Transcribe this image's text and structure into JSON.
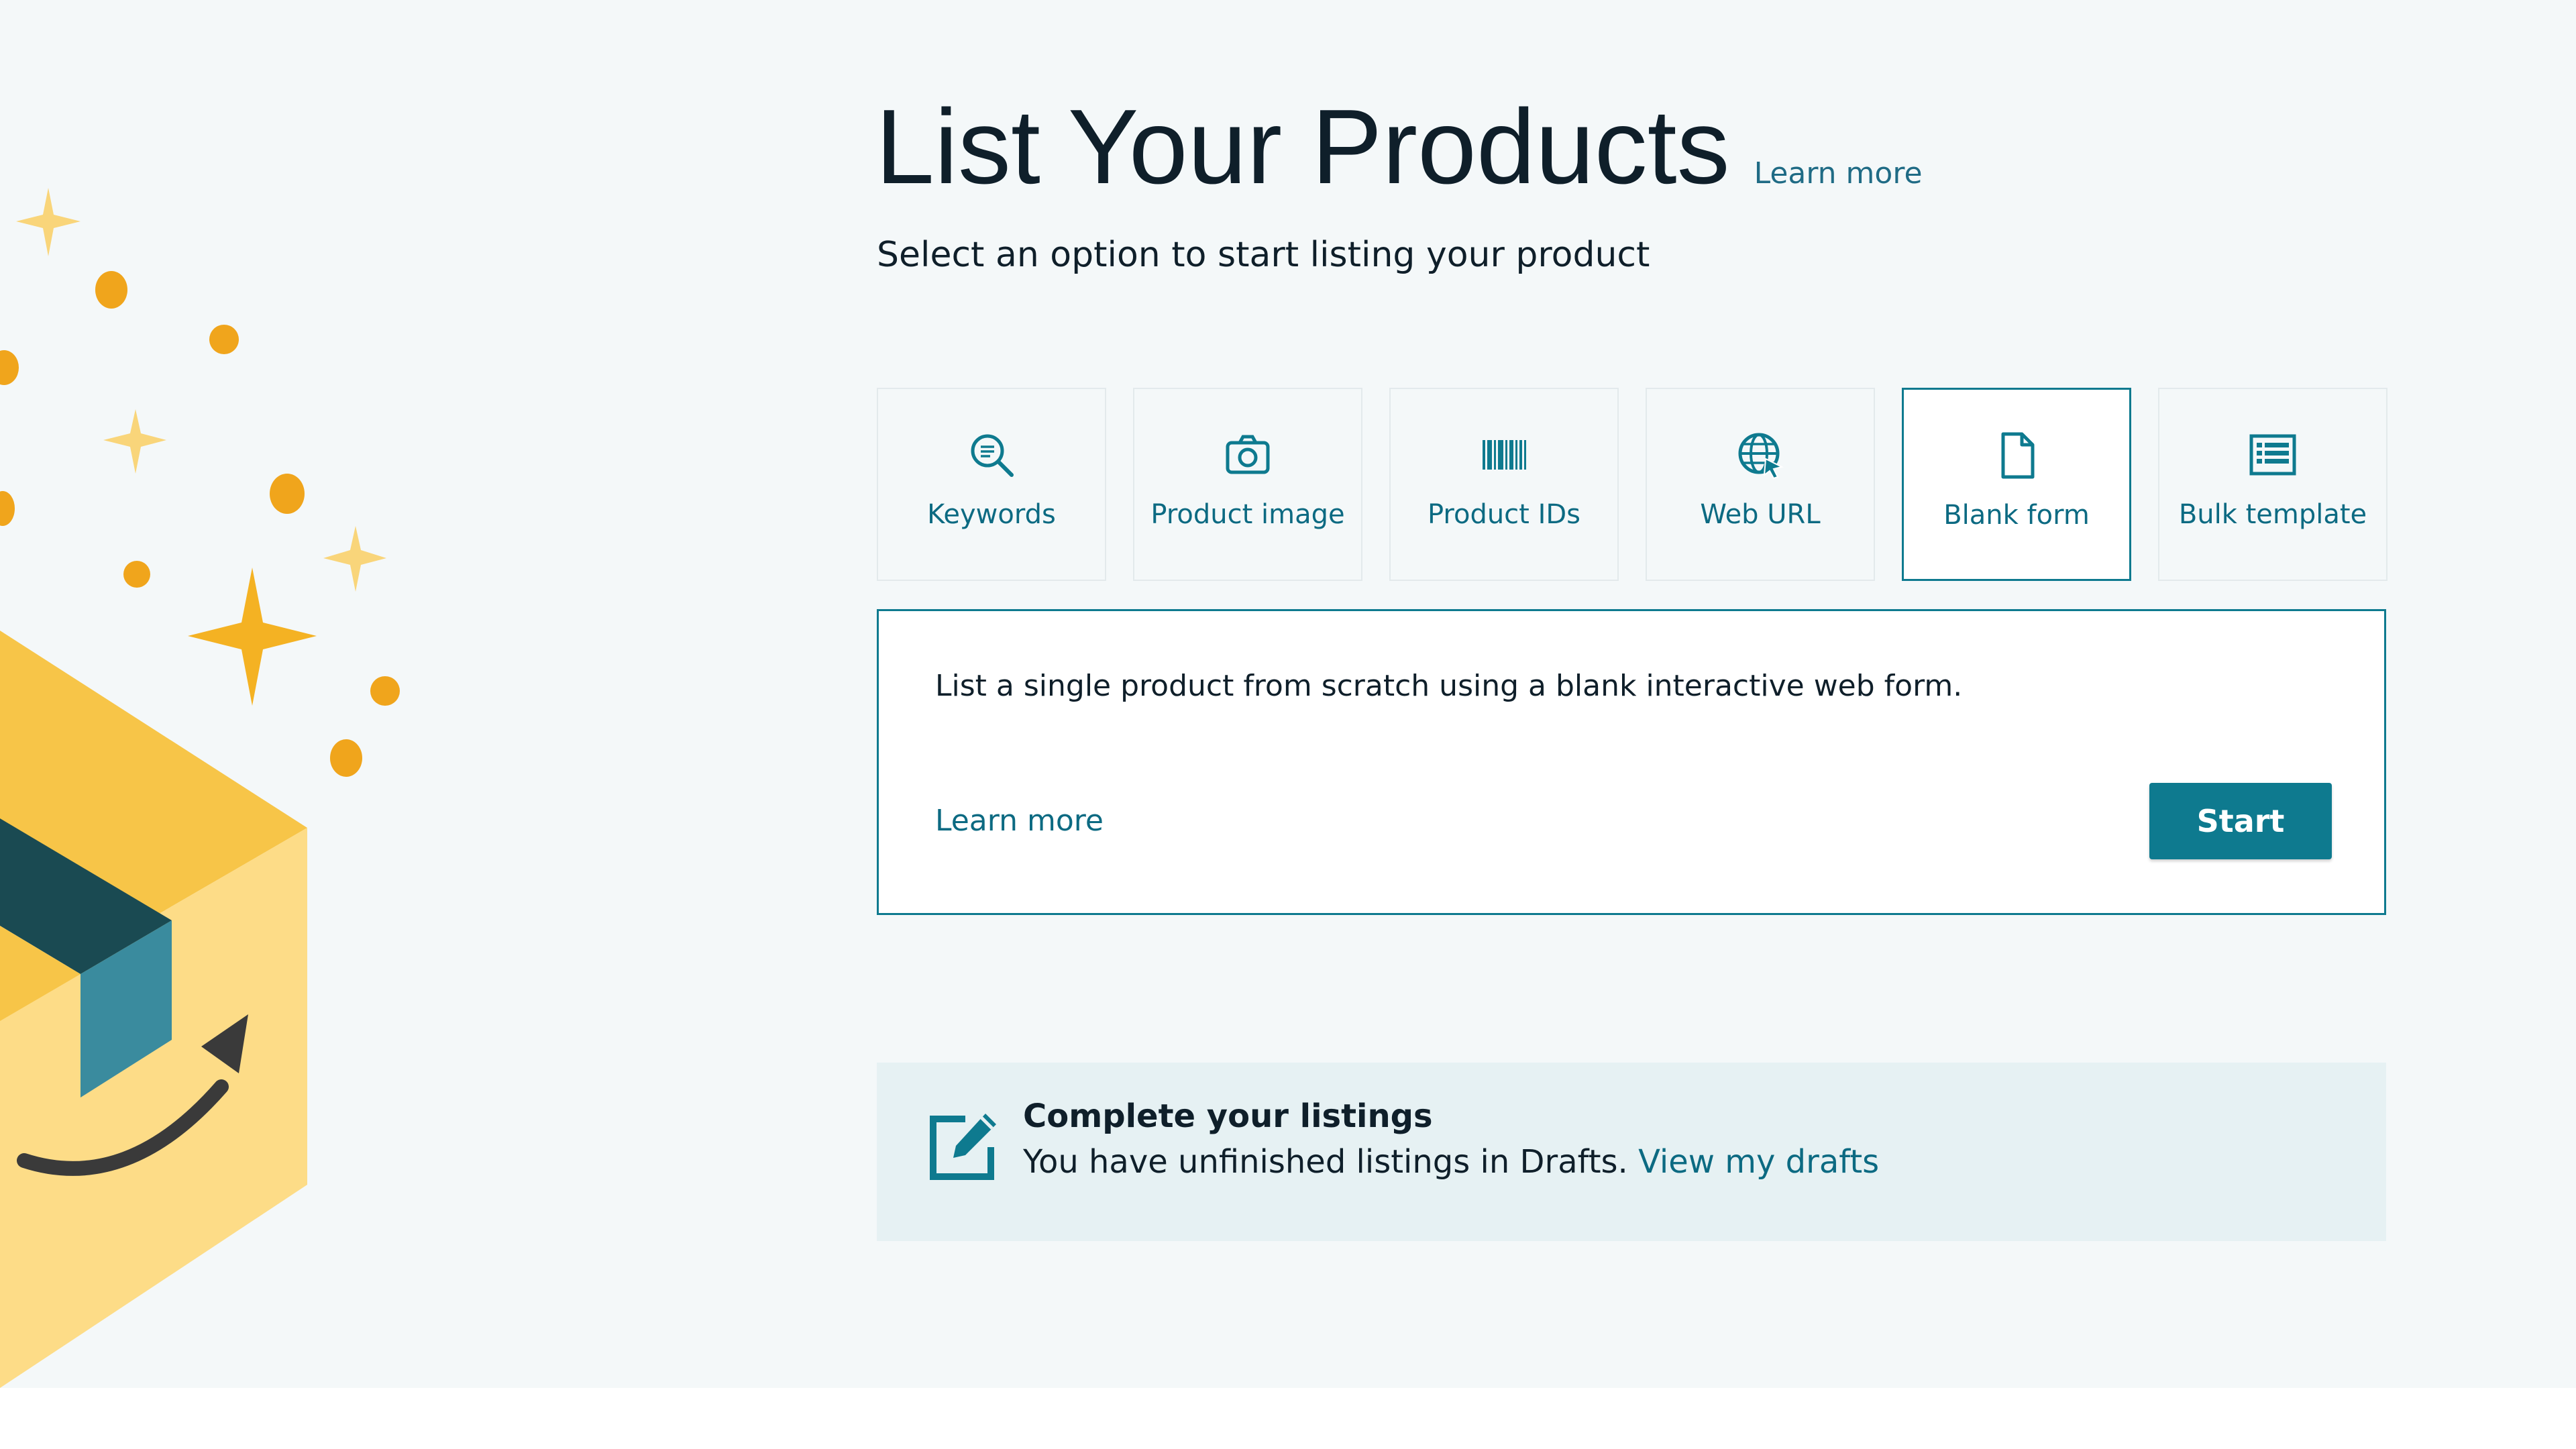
{
  "header": {
    "title": "List Your Products",
    "title_link": "Learn more",
    "subtitle": "Select an option to start listing your product"
  },
  "options": [
    {
      "label": "Keywords",
      "icon": "magnifier-search-icon"
    },
    {
      "label": "Product image",
      "icon": "camera-icon"
    },
    {
      "label": "Product IDs",
      "icon": "barcode-icon"
    },
    {
      "label": "Web URL",
      "icon": "globe-cursor-icon"
    },
    {
      "label": "Blank form",
      "icon": "blank-document-icon",
      "selected": true
    },
    {
      "label": "Bulk template",
      "icon": "spreadsheet-template-icon"
    }
  ],
  "detail": {
    "description": "List a single product from scratch using a blank interactive web form.",
    "learn_more": "Learn more",
    "start_label": "Start"
  },
  "drafts": {
    "title": "Complete your listings",
    "text": "You have unfinished listings in Drafts.",
    "link": "View my drafts",
    "icon": "edit-note-icon"
  },
  "colors": {
    "accent": "#0e7a8f",
    "link": "#0c6a82",
    "page_bg": "#f4f8f9",
    "banner_bg": "#e6f1f3",
    "illustration_yellow": "#f4b223"
  }
}
